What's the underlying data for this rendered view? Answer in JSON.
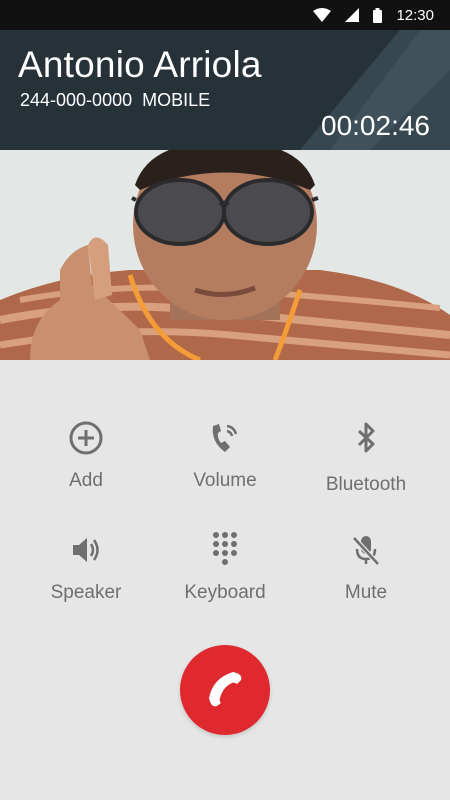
{
  "status_bar": {
    "time": "12:30"
  },
  "call": {
    "caller_name": "Antonio Arriola",
    "number": "244-000-0000",
    "number_type": "MOBILE",
    "duration": "00:02:46"
  },
  "controls": [
    {
      "label": "Add",
      "icon": "add-circle-icon"
    },
    {
      "label": "Volume",
      "icon": "phone-volume-icon"
    },
    {
      "label": "Bluetooth",
      "icon": "bluetooth-icon"
    },
    {
      "label": "Speaker",
      "icon": "speaker-icon"
    },
    {
      "label": "Keyboard",
      "icon": "dialpad-icon"
    },
    {
      "label": "Mute",
      "icon": "mic-off-icon"
    }
  ],
  "colors": {
    "header_bg": "#263238",
    "end_call": "#e0282f",
    "controls_bg": "#e6e6e6",
    "control_text": "#6f6f6f"
  }
}
